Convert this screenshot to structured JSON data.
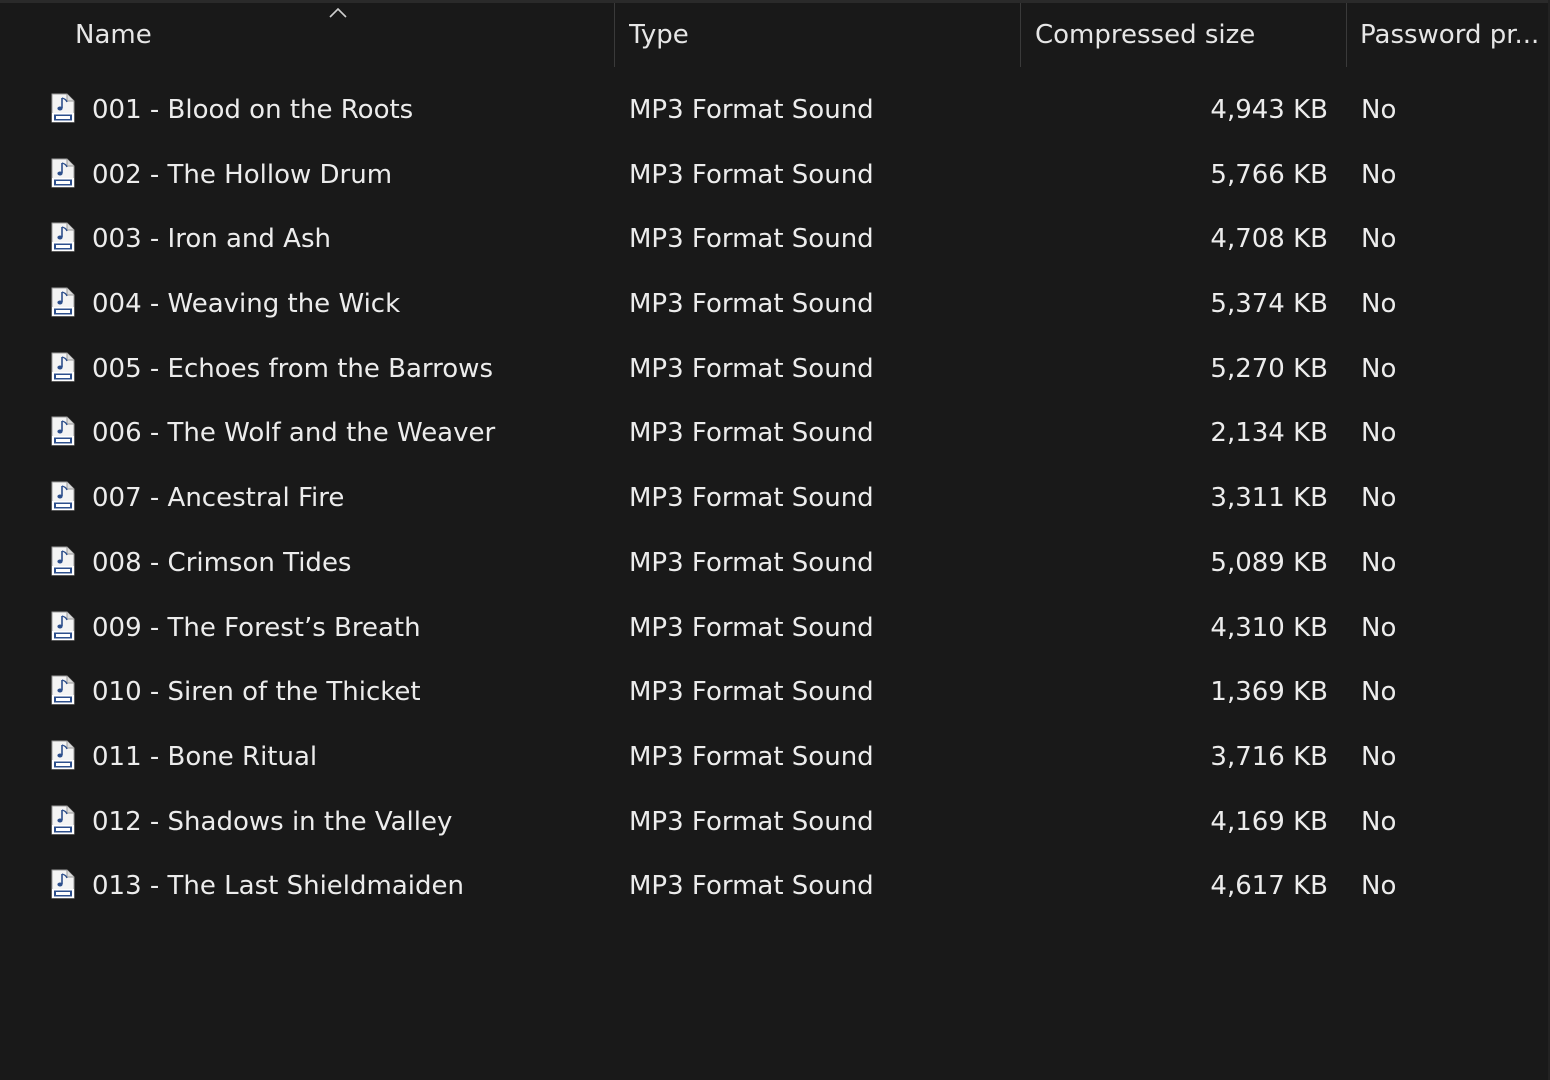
{
  "columns": {
    "name": "Name",
    "type": "Type",
    "size": "Compressed size",
    "password": "Password pr..."
  },
  "files": [
    {
      "name": "001 - Blood on the Roots",
      "type": "MP3 Format Sound",
      "size": "4,943 KB",
      "password": "No"
    },
    {
      "name": "002 - The Hollow Drum",
      "type": "MP3 Format Sound",
      "size": "5,766 KB",
      "password": "No"
    },
    {
      "name": "003 - Iron and Ash",
      "type": "MP3 Format Sound",
      "size": "4,708 KB",
      "password": "No"
    },
    {
      "name": "004 - Weaving the Wick",
      "type": "MP3 Format Sound",
      "size": "5,374 KB",
      "password": "No"
    },
    {
      "name": "005 - Echoes from the Barrows",
      "type": "MP3 Format Sound",
      "size": "5,270 KB",
      "password": "No"
    },
    {
      "name": "006 - The Wolf and the Weaver",
      "type": "MP3 Format Sound",
      "size": "2,134 KB",
      "password": "No"
    },
    {
      "name": "007 - Ancestral Fire",
      "type": "MP3 Format Sound",
      "size": "3,311 KB",
      "password": "No"
    },
    {
      "name": "008 - Crimson Tides",
      "type": "MP3 Format Sound",
      "size": "5,089 KB",
      "password": "No"
    },
    {
      "name": "009 - The Forest’s Breath",
      "type": "MP3 Format Sound",
      "size": "4,310 KB",
      "password": "No"
    },
    {
      "name": "010 - Siren of the Thicket",
      "type": "MP3 Format Sound",
      "size": "1,369 KB",
      "password": "No"
    },
    {
      "name": "011 - Bone Ritual",
      "type": "MP3 Format Sound",
      "size": "3,716 KB",
      "password": "No"
    },
    {
      "name": "012 - Shadows in the Valley",
      "type": "MP3 Format Sound",
      "size": "4,169 KB",
      "password": "No"
    },
    {
      "name": "013 - The Last Shieldmaiden",
      "type": "MP3 Format Sound",
      "size": "4,617 KB",
      "password": "No"
    }
  ],
  "file_icon": "mp3-file-icon",
  "sort_indicator": "sort-ascending-icon",
  "colors": {
    "background": "#191919",
    "text": "#ececec",
    "separator": "#3a3a3a"
  }
}
